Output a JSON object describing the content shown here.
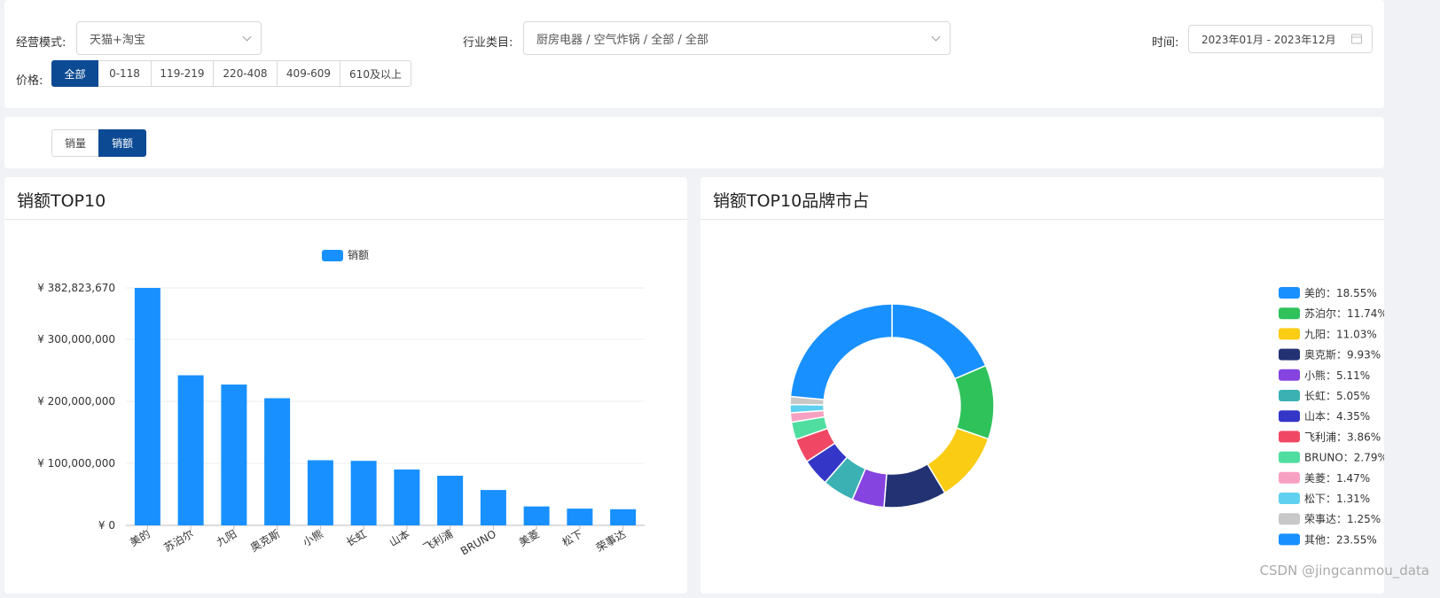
{
  "filters": {
    "mode_label": "经营模式:",
    "mode_value": "天猫+淘宝",
    "industry_label": "行业类目:",
    "industry_value": "厨房电器 / 空气炸锅 / 全部 / 全部",
    "time_label": "时间:",
    "time_value": "2023年01月 - 2023年12月",
    "price_label": "价格:",
    "price_options": [
      "全部",
      "0-118",
      "119-219",
      "220-408",
      "409-609",
      "610及以上"
    ],
    "price_selected": "全部"
  },
  "metric_toggle": {
    "options": [
      "销量",
      "销额"
    ],
    "selected": "销额"
  },
  "bar_panel": {
    "title": "销额TOP10"
  },
  "pie_panel": {
    "title": "销额TOP10品牌市占"
  },
  "watermark": "CSDN @jingcanmou_data",
  "colors": {
    "accent": "#0c4a94",
    "bar": "#1890ff",
    "slices": [
      "#1890ff",
      "#2fc25b",
      "#facc14",
      "#223273",
      "#8543e0",
      "#3cb1b4",
      "#3436c7",
      "#f04864",
      "#4fdea0",
      "#f7a1c2",
      "#60d0f0",
      "#c8c8c8",
      "#1890ff"
    ]
  },
  "chart_data": [
    {
      "type": "bar",
      "legend": [
        "销额"
      ],
      "categories": [
        "美的",
        "苏泊尔",
        "九阳",
        "奥克斯",
        "小熊",
        "长虹",
        "山本",
        "飞利浦",
        "BRUNO",
        "美菱",
        "松下",
        "荣事达"
      ],
      "series": [
        {
          "name": "销额",
          "values": [
            382823670,
            242000000,
            227000000,
            205000000,
            105000000,
            104000000,
            90000000,
            80000000,
            57000000,
            30500000,
            27000000,
            26000000
          ]
        }
      ],
      "y_ticks": [
        "¥ 0",
        "¥ 100,000,000",
        "¥ 200,000,000",
        "¥ 300,000,000",
        "¥ 382,823,670"
      ],
      "y_tick_values": [
        0,
        100000000,
        200000000,
        300000000,
        382823670
      ],
      "ylim": [
        0,
        382823670
      ],
      "grid": true,
      "legend_position": "top"
    },
    {
      "type": "pie",
      "donut": true,
      "labels": [
        "美的",
        "苏泊尔",
        "九阳",
        "奥克斯",
        "小熊",
        "长虹",
        "山本",
        "飞利浦",
        "BRUNO",
        "美菱",
        "松下",
        "荣事达",
        "其他"
      ],
      "values": [
        18.55,
        11.74,
        11.03,
        9.93,
        5.11,
        5.05,
        4.35,
        3.86,
        2.79,
        1.47,
        1.31,
        1.25,
        23.55
      ],
      "legend_entries": [
        "美的：18.55%",
        "苏泊尔：11.74%",
        "九阳：11.03%",
        "奥克斯：9.93%",
        "小熊：5.11%",
        "长虹：5.05%",
        "山本：4.35%",
        "飞利浦：3.86%",
        "BRUNO：2.79%",
        "美菱：1.47%",
        "松下：1.31%",
        "荣事达：1.25%",
        "其他：23.55%"
      ],
      "legend_position": "right"
    }
  ]
}
